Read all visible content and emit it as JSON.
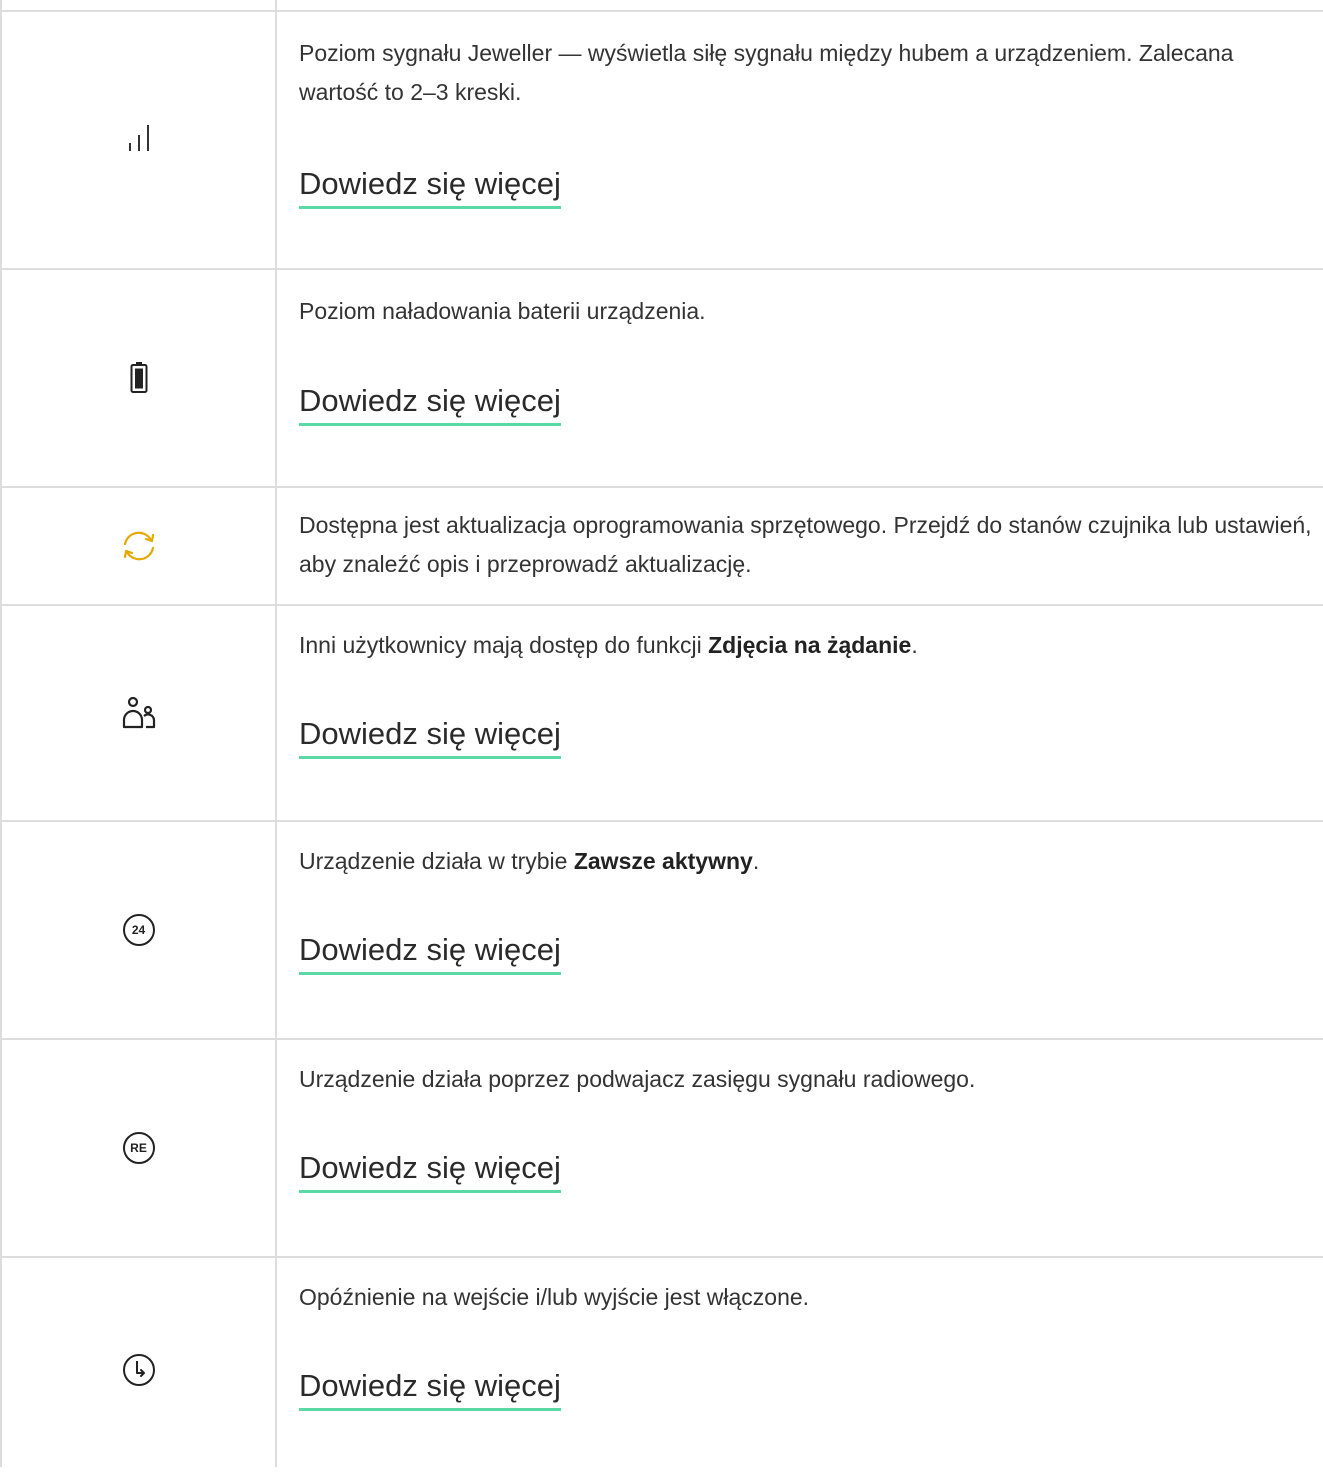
{
  "link_label": "Dowiedz się więcej",
  "accent_color": "#5ad8a6",
  "update_icon_color": "#e6a800",
  "rows": [
    {
      "icon": "signal-strength-icon",
      "text": "Poziom sygnału Jeweller — wyświetla siłę sygnału między hubem a urządzeniem. Zalecana wartość to 2–3 kreski.",
      "has_link": true
    },
    {
      "icon": "battery-icon",
      "text": "Poziom naładowania baterii urządzenia.",
      "has_link": true
    },
    {
      "icon": "firmware-update-icon",
      "text": "Dostępna jest aktualizacja oprogramowania sprzętowego. Przejdź do stanów czujnika lub ustawień, aby znaleźć opis i przeprowadź aktualizację.",
      "has_link": false
    },
    {
      "icon": "users-icon",
      "text_before": "Inni użytkownicy mają dostęp do funkcji ",
      "text_bold": "Zdjęcia na żądanie",
      "text_after": ".",
      "has_link": true
    },
    {
      "icon": "always-active-24-icon",
      "icon_label": "24",
      "text_before": "Urządzenie działa w trybie ",
      "text_bold": "Zawsze aktywny",
      "text_after": ".",
      "has_link": true
    },
    {
      "icon": "range-extender-re-icon",
      "icon_label": "RE",
      "text": "Urządzenie działa poprzez podwajacz zasięgu sygnału radiowego.",
      "has_link": true
    },
    {
      "icon": "delay-clock-icon",
      "text": "Opóźnienie na wejście i/lub wyjście jest włączone.",
      "has_link": true
    }
  ]
}
